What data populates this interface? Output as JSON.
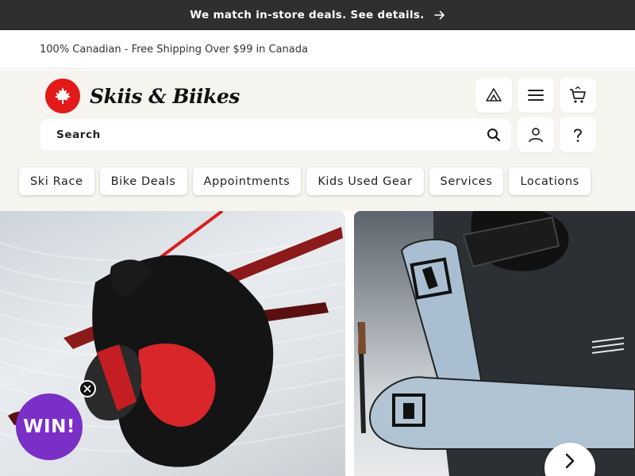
{
  "promo": {
    "text": "We match in-store deals. See details.",
    "arrow_icon": "arrow-right-icon"
  },
  "shipping": {
    "text": "100% Canadian - Free Shipping Over $99 in Canada"
  },
  "brand": {
    "name": "Skiis & Biikes",
    "logo_icon": "maple-leaf-icon",
    "logo_color": "#e21a1a"
  },
  "header_actions": [
    {
      "icon": "mountain-icon"
    },
    {
      "icon": "menu-icon"
    },
    {
      "icon": "cart-icon"
    },
    {
      "icon": "account-icon"
    },
    {
      "icon": "help-icon"
    }
  ],
  "search": {
    "placeholder": "Search",
    "icon": "search-icon"
  },
  "categories": [
    "Ski Race",
    "Bike Deals",
    "Appointments",
    "Kids Used Gear",
    "Services",
    "Locations"
  ],
  "hero": {
    "left_image": "skier-carving-image",
    "right_image": "skier-holding-skis-image"
  },
  "win_badge": {
    "label": "WIN!",
    "color": "#7a2fc7"
  },
  "carousel": {
    "next_icon": "chevron-right-icon"
  },
  "colors": {
    "promo_bg": "#2f2f2f",
    "header_bg": "#f6f4ef"
  }
}
